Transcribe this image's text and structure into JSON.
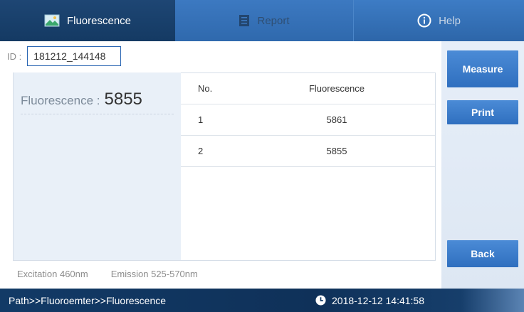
{
  "tabs": [
    {
      "label": "Fluorescence",
      "icon": "fluorescence-icon"
    },
    {
      "label": "Report",
      "icon": "report-icon"
    },
    {
      "label": "Help",
      "icon": "info-icon"
    }
  ],
  "id_field": {
    "label": "ID :",
    "value": "181212_144148"
  },
  "result": {
    "label": "Fluorescence :",
    "value": "5855"
  },
  "table": {
    "headers": [
      "No.",
      "Fluorescence"
    ],
    "rows": [
      [
        "1",
        "5861"
      ],
      [
        "2",
        "5855"
      ]
    ]
  },
  "info": {
    "excitation": "Excitation 460nm",
    "emission": "Emission 525-570nm"
  },
  "buttons": {
    "measure": "Measure",
    "print": "Print",
    "back": "Back"
  },
  "status": {
    "path": "Path>>Fluoroemter>>Fluorescence",
    "datetime": "2018-12-12 14:41:58"
  },
  "colors": {
    "accent": "#2f6fbf",
    "header_dark": "#0f2b4d",
    "panel_bg": "#e9f0f8"
  }
}
